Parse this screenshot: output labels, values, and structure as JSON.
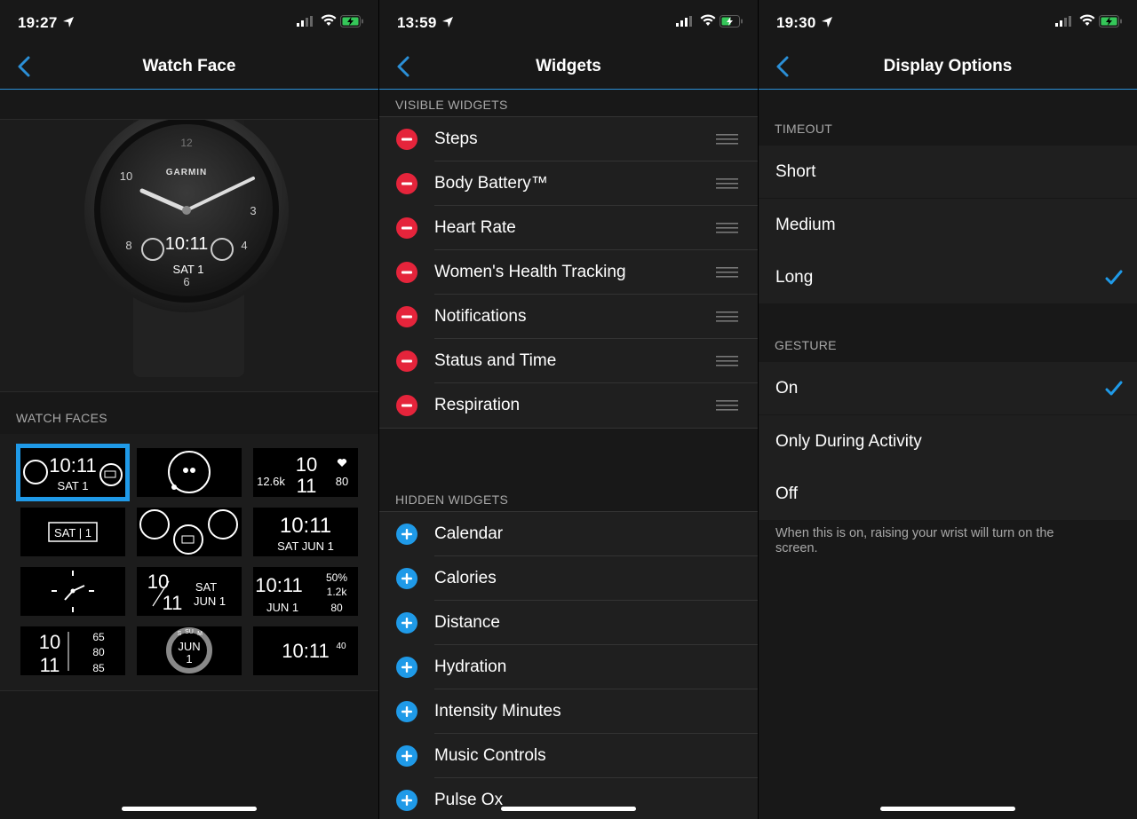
{
  "colors": {
    "accent": "#2b8fd6",
    "remove": "#e5243b",
    "add": "#1f9ae8",
    "check": "#1f9ae8"
  },
  "watch_face": {
    "status_time": "19:27",
    "title": "Watch Face",
    "watch_brand": "GARMIN",
    "watch_time": "10:11",
    "watch_date": "SAT 1",
    "section_label": "WATCH FACES",
    "faces": [
      {
        "name": "steps-time-battery",
        "selected": true,
        "text": [
          "10:11",
          "SAT 1"
        ]
      },
      {
        "name": "steps-ring",
        "selected": false,
        "text": []
      },
      {
        "name": "steps-time-heart",
        "selected": false,
        "text": [
          "12.6k",
          "10",
          "11",
          "80"
        ]
      },
      {
        "name": "date-box",
        "selected": false,
        "text": [
          "SAT | 1"
        ]
      },
      {
        "name": "triple-dials",
        "selected": false,
        "text": []
      },
      {
        "name": "digital-date",
        "selected": false,
        "text": [
          "10:11",
          "SAT JUN 1"
        ]
      },
      {
        "name": "analog",
        "selected": false,
        "text": []
      },
      {
        "name": "split-time-date",
        "selected": false,
        "text": [
          "10",
          "11",
          "SAT",
          "JUN 1"
        ]
      },
      {
        "name": "time-stats",
        "selected": false,
        "text": [
          "10:11",
          "JUN 1",
          "50%",
          "1.2k",
          "80"
        ]
      },
      {
        "name": "stacked-stats",
        "selected": false,
        "text": [
          "10",
          "11",
          "65",
          "80",
          "85"
        ]
      },
      {
        "name": "weekday-ring",
        "selected": false,
        "text": [
          "JUN",
          "1",
          "S",
          "SU",
          "M"
        ]
      },
      {
        "name": "seconds",
        "selected": false,
        "text": [
          "10:11",
          "40"
        ]
      }
    ]
  },
  "widgets": {
    "status_time": "13:59",
    "title": "Widgets",
    "visible_label": "VISIBLE WIDGETS",
    "visible": [
      "Steps",
      "Body Battery™",
      "Heart Rate",
      "Women's Health Tracking",
      "Notifications",
      "Status and Time",
      "Respiration"
    ],
    "hidden_label": "HIDDEN WIDGETS",
    "hidden": [
      "Calendar",
      "Calories",
      "Distance",
      "Hydration",
      "Intensity Minutes",
      "Music Controls",
      "Pulse Ox"
    ]
  },
  "display": {
    "status_time": "19:30",
    "title": "Display Options",
    "timeout_label": "TIMEOUT",
    "timeout_options": [
      "Short",
      "Medium",
      "Long"
    ],
    "timeout_selected": "Long",
    "gesture_label": "GESTURE",
    "gesture_options": [
      "On",
      "Only During Activity",
      "Off"
    ],
    "gesture_selected": "On",
    "footer": "When this is on, raising your wrist will turn on the screen."
  }
}
